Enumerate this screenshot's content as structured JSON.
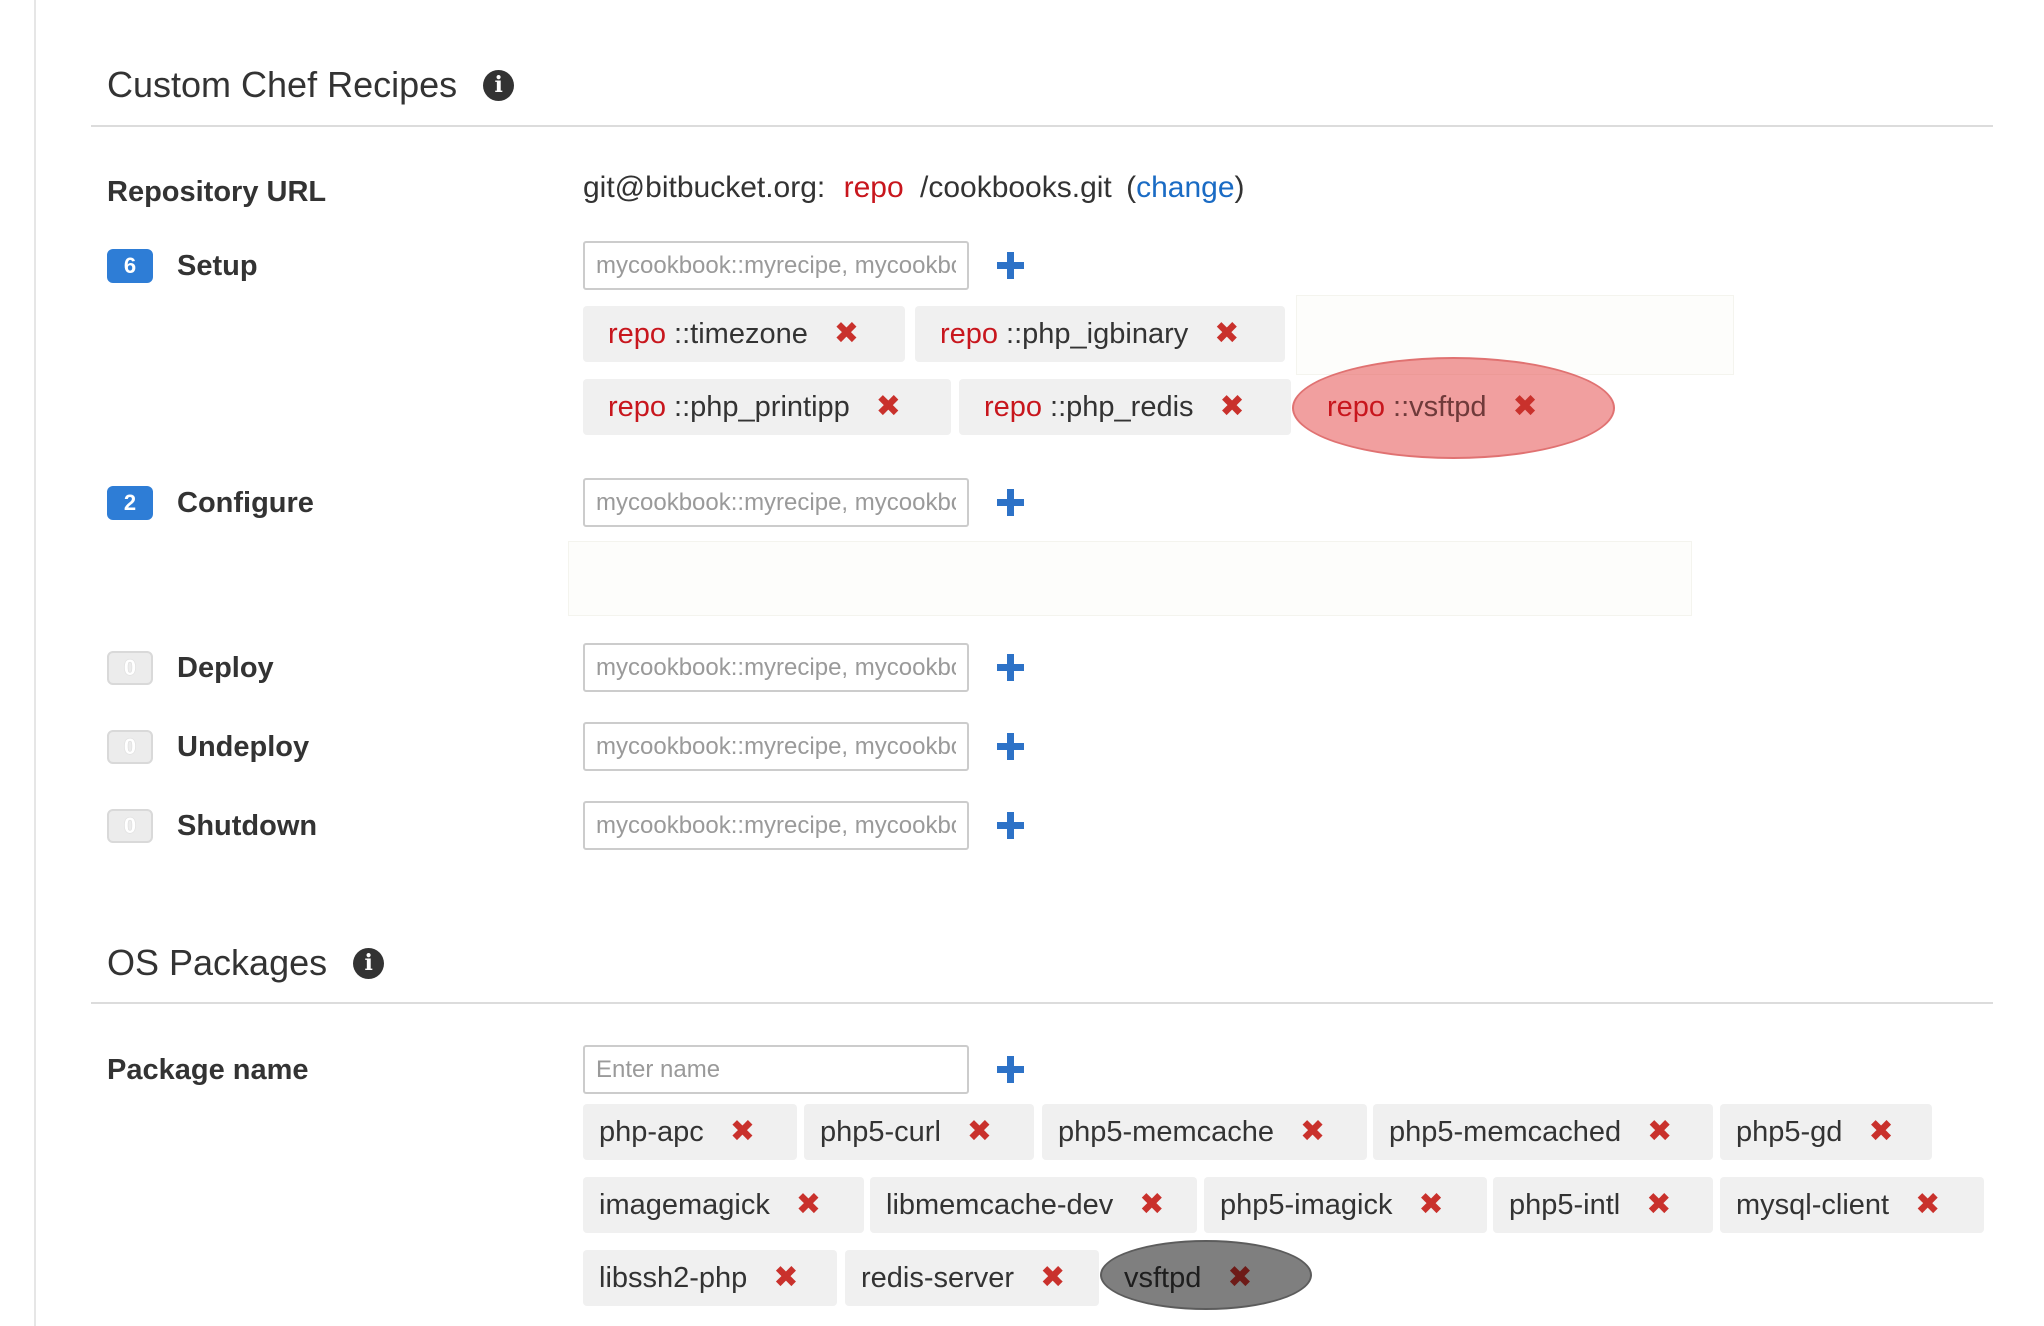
{
  "chef": {
    "title": "Custom Chef Recipes",
    "repo_label": "Repository URL",
    "repo_url": {
      "prefix": "git@bitbucket.org:",
      "repo": "repo",
      "suffix": "/cookbooks.git",
      "open_paren": "(",
      "change": "change",
      "close_paren": ")"
    },
    "recipe_placeholder": "mycookbook::myrecipe, mycookbook",
    "events": [
      {
        "label": "Setup",
        "count": "6"
      },
      {
        "label": "Configure",
        "count": "2"
      },
      {
        "label": "Deploy",
        "count": "0"
      },
      {
        "label": "Undeploy",
        "count": "0"
      },
      {
        "label": "Shutdown",
        "count": "0"
      }
    ],
    "setup_recipes": [
      {
        "repo": "repo",
        "name": "::timezone"
      },
      {
        "repo": "repo",
        "name": "::php_igbinary"
      },
      {
        "repo": "repo",
        "name": "::php_printipp"
      },
      {
        "repo": "repo",
        "name": "::php_redis"
      },
      {
        "repo": "repo",
        "name": "::vsftpd"
      }
    ]
  },
  "os": {
    "title": "OS Packages",
    "package_label": "Package name",
    "package_placeholder": "Enter name",
    "packages": [
      "php-apc",
      "php5-curl",
      "php5-memcache",
      "php5-memcached",
      "php5-gd",
      "imagemagick",
      "libmemcache-dev",
      "php5-imagick",
      "php5-intl",
      "mysql-client",
      "libssh2-php",
      "redis-server",
      "vsftpd"
    ]
  },
  "icons": {
    "info": "info-icon",
    "add": "plus-icon",
    "remove": "remove-x-icon"
  },
  "colors": {
    "accent": "#2e7dd6",
    "repo_text": "#c8161d",
    "remove_x": "#c9312c",
    "link": "#1a6bc4"
  }
}
